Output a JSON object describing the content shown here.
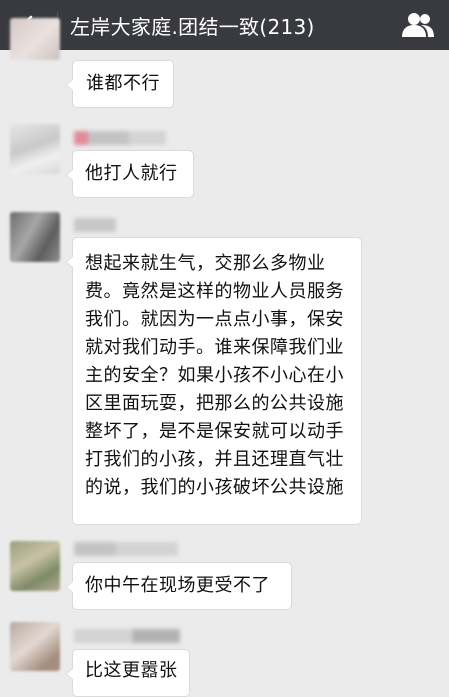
{
  "header": {
    "title": "左岸大家庭.团结一致(213)",
    "back_icon": "back-arrow-icon",
    "members_icon": "group-members-icon",
    "bg_color": "#393a3f"
  },
  "messages": [
    {
      "text": "谁都不行"
    },
    {
      "text": "他打人就行"
    },
    {
      "text": "想起来就生气，交那么多物业费。竟然是这样的物业人员服务我们。就因为一点点小事，保安就对我们动手。谁来保障我们业主的安全？如果小孩不小心在小区里面玩耍，把那么的公共设施整坏了，是不是保安就可以动手打我们的小孩，并且还理直气壮的说，我们的小孩破坏公共设施"
    },
    {
      "text": "你中午在现场更受不了"
    },
    {
      "text": "比这更嚣张"
    }
  ]
}
